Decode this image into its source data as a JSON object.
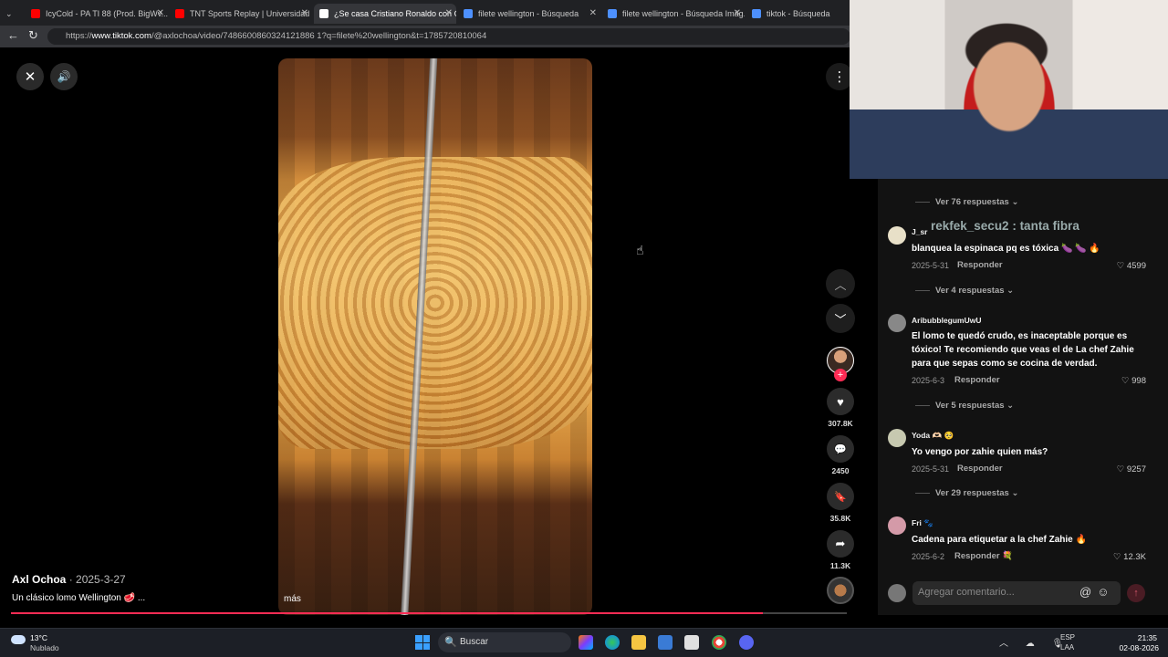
{
  "browser": {
    "tabs": [
      {
        "title": "IcyCold - PA TI 88 (Prod. BigWv...",
        "favicon_color": "#ff0000"
      },
      {
        "title": "TNT Sports Replay | Universidad d...",
        "favicon_color": "#ff0000"
      },
      {
        "title": "¿Se casa Cristiano Ronaldo con Ge...",
        "favicon_color": "#ffffff"
      },
      {
        "title": "filete wellington - Búsqueda",
        "favicon_color": "#4d90fe"
      },
      {
        "title": "filete wellington - Búsqueda Imág...",
        "favicon_color": "#4d90fe"
      },
      {
        "title": "tiktok - Búsqueda",
        "favicon_color": "#4d90fe"
      }
    ],
    "url_prefix": "https://",
    "url_host": "www.tiktok.com",
    "url_path": "/@axlochoa/video/7486600860324121886 1?q=filete%20wellington&t=1785720810064"
  },
  "video": {
    "author": "Axl Ochoa",
    "date": " · 2025-3-27",
    "caption": "Un clásico lomo Wellington 🥩 ...",
    "more_label": "más",
    "progress_fraction": 0.9,
    "likes": "307.8K",
    "comments": "2450",
    "saves": "35.8K",
    "shares": "11.3K",
    "icons": {
      "close": "✕",
      "volume": "🔊",
      "more": "⋮",
      "up": "︿",
      "down": "﹀",
      "like": "♥",
      "comment": "💬",
      "save": "🔖",
      "share": "➦",
      "follow": "+"
    }
  },
  "comments": {
    "replies_top": "Ver 76 respuestas ⌄",
    "items": [
      {
        "user": "J_sr",
        "text": "blanquea la espinaca pq es tóxica 🍆 🍆 🔥",
        "date": "2025-5-31",
        "reply": "Responder",
        "likes": "♡ 4599",
        "replies": "Ver 4 respuestas ⌄",
        "avatar_color": "#e8e0c8"
      },
      {
        "user": "AribubblegumUwU",
        "text": "El lomo te quedó crudo, es inaceptable porque es tóxico! Te recomiendo que veas el de La chef Zahie para que sepas como se cocina de verdad.",
        "date": "2025-6-3",
        "reply": "Responder",
        "likes": "♡ 998",
        "replies": "Ver 5 respuestas ⌄",
        "avatar_color": "#888888"
      },
      {
        "user": "Yoda 🫶🏻 🥺",
        "text": "Yo vengo por zahie quien más?",
        "date": "2025-5-31",
        "reply": "Responder",
        "likes": "♡ 9257",
        "replies": "Ver 29 respuestas ⌄",
        "avatar_color": "#c7c9b0"
      },
      {
        "user": "Fri 🐾",
        "text": "Cadena para etiquetar a la chef Zahie 🔥",
        "date": "2025-6-2",
        "reply": "Responder 💐",
        "likes": "♡ 12.3K",
        "replies": "",
        "avatar_color": "#d49aa8"
      }
    ],
    "overlay_chat": "rekfek_secu2 : tanta fibra",
    "input_placeholder": "Agregar comentario...",
    "input_icons": "@☺",
    "send_icon": "↑"
  },
  "taskbar": {
    "temp": "13°C",
    "weather": "Nublado",
    "search_label": "Buscar",
    "search_icon": "🔍",
    "tray_icons": "︿ ☁ 🎙",
    "lang_top": "ESP",
    "lang_bottom": "LAA",
    "time": "21:35",
    "date": "02-08-2026"
  }
}
